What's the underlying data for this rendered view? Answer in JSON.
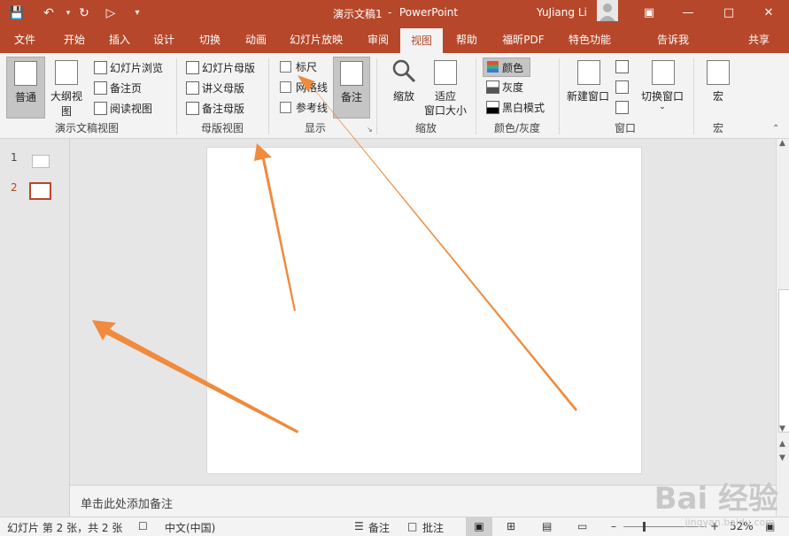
{
  "window": {
    "doc_title": "演示文稿1",
    "separator": "-",
    "app_name": "PowerPoint",
    "user": "YuJiang Li"
  },
  "tabs": [
    "文件",
    "开始",
    "插入",
    "设计",
    "切换",
    "动画",
    "幻灯片放映",
    "审阅",
    "视图",
    "帮助",
    "福昕PDF",
    "特色功能",
    "告诉我",
    "共享"
  ],
  "ribbon": {
    "groups": {
      "presentation_views": {
        "label": "演示文稿视图",
        "normal": "普通",
        "outline": "大纲视图",
        "slide_sorter": "幻灯片浏览",
        "notes_page": "备注页",
        "reading_view": "阅读视图"
      },
      "master_views": {
        "label": "母版视图",
        "slide_master": "幻灯片母版",
        "handout_master": "讲义母版",
        "notes_master": "备注母版"
      },
      "show": {
        "label": "显示",
        "ruler": "标尺",
        "gridlines": "网格线",
        "guides": "参考线",
        "notes": "备注"
      },
      "zoom": {
        "label": "缩放",
        "zoom": "缩放",
        "fit_line1": "适应",
        "fit_line2": "窗口大小"
      },
      "color": {
        "label": "颜色/灰度",
        "color": "颜色",
        "grayscale": "灰度",
        "bw": "黑白模式"
      },
      "window": {
        "label": "窗口",
        "new_window": "新建窗口",
        "switch_windows": "切换窗口"
      },
      "macros": {
        "label": "宏",
        "macros": "宏"
      }
    }
  },
  "thumbnails": [
    {
      "num": "1"
    },
    {
      "num": "2"
    }
  ],
  "notes_placeholder": "单击此处添加备注",
  "status": {
    "slide_info": "幻灯片 第 2 张，共 2 张",
    "language": "中文(中国)",
    "notes": "备注",
    "comments": "批注",
    "zoom": "52%"
  },
  "watermark": {
    "brand": "Bai 经验",
    "url": "jingyan.baidu.com"
  },
  "colors": {
    "accent": "#b7472a",
    "arrow": "#f08a3c"
  }
}
